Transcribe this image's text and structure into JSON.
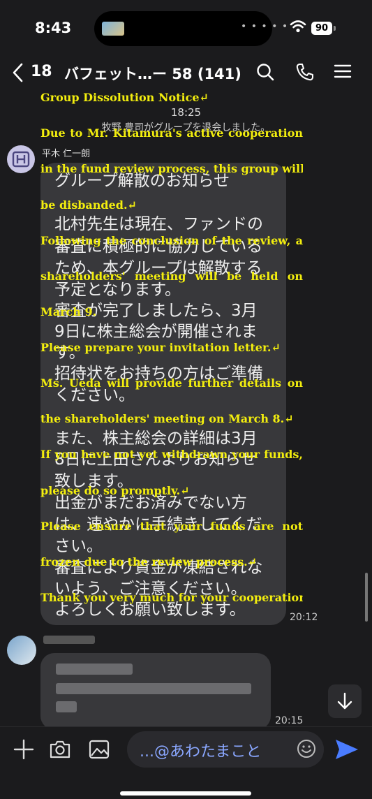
{
  "status": {
    "time": "8:43",
    "battery": "90"
  },
  "header": {
    "unread_count": "18",
    "title": "バフェット…ー 58 (141)"
  },
  "system": {
    "time": "18:25",
    "notice": "牧野 豊司がグループを退会しました。"
  },
  "message1": {
    "avatar_text": "IH",
    "sender": "平木 仁一朗",
    "body_lines": [
      "グループ解散のお知らせ",
      "北村先生は現在、ファンドの",
      "審査に積極的に協力している",
      "ため、本グループは解散する",
      "予定となります。",
      "審査が完了しましたら、3月",
      "9日に株主総会が開催されま",
      "す。",
      "招待状をお持ちの方はご準備",
      "ください。",
      "また、株主総会の詳細は3月",
      "8日に上田さんよりお知らせ",
      "致します。",
      "出金がまだお済みでない方",
      "は、速やかに手続きしてくだ",
      "さい。",
      "審査により資金が凍結されな",
      "いよう、ご注意ください。",
      "よろしくお願い致します。"
    ],
    "time": "20:12"
  },
  "overlay_lines": [
    "Group Dissolution Notice↵",
    "Due to Mr. Kitamura's active cooperation",
    "in the fund review process, this group will",
    "be disbanded.↵",
    "Following the conclusion of the review, a",
    "shareholders' meeting will be held on",
    "March 9.",
    "Please prepare your invitation letter.↵",
    "Ms. Ueda will provide further details on",
    "the shareholders' meeting on March 8.↵",
    "If you have not yet withdrawn your funds,",
    "please do so promptly.↵",
    "Please ensure that your funds are not",
    "frozen due to the review process.↵",
    "Thank you very much for your cooperation.↵"
  ],
  "message2": {
    "time": "20:15"
  },
  "composer": {
    "placeholder": "...@あわたまこと"
  },
  "colors": {
    "overlay_text": "#f3ee0e",
    "send_accent": "#4a7cff",
    "bubble": "#38383b"
  }
}
